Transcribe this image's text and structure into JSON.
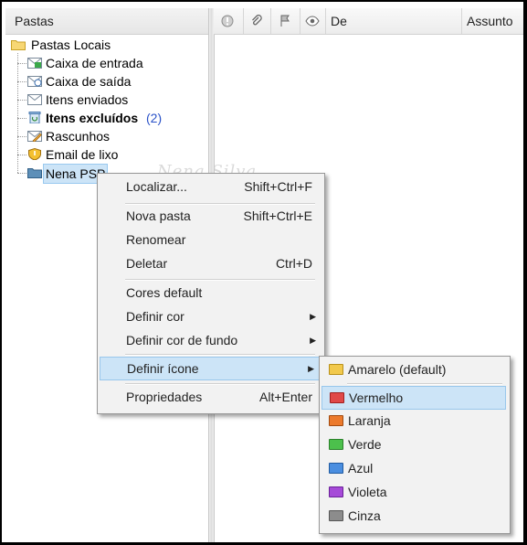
{
  "folders_panel": {
    "header": "Pastas",
    "root": "Pastas Locais",
    "items": [
      {
        "label": "Caixa de entrada",
        "icon": "inbox-icon"
      },
      {
        "label": "Caixa de saída",
        "icon": "outbox-icon"
      },
      {
        "label": "Itens enviados",
        "icon": "sent-icon"
      },
      {
        "label": "Itens excluídos",
        "count": "(2)",
        "icon": "trash-icon"
      },
      {
        "label": "Rascunhos",
        "icon": "drafts-icon"
      },
      {
        "label": "Email de lixo",
        "icon": "junk-icon"
      },
      {
        "label": "Nena PSP",
        "icon": "folder-icon"
      }
    ]
  },
  "messages_header": {
    "col_from": "De",
    "col_subject": "Assunto"
  },
  "watermark": "Nena Silva",
  "context_menu": {
    "items": [
      {
        "label": "Localizar...",
        "shortcut": "Shift+Ctrl+F"
      },
      {
        "label": "Nova pasta",
        "shortcut": "Shift+Ctrl+E"
      },
      {
        "label": "Renomear",
        "shortcut": ""
      },
      {
        "label": "Deletar",
        "shortcut": "Ctrl+D"
      },
      {
        "label": "Cores default",
        "shortcut": ""
      },
      {
        "label": "Definir cor",
        "shortcut": ""
      },
      {
        "label": "Definir cor de fundo",
        "shortcut": ""
      },
      {
        "label": "Definir ícone",
        "shortcut": ""
      },
      {
        "label": "Propriedades",
        "shortcut": "Alt+Enter"
      }
    ]
  },
  "icon_submenu": {
    "items": [
      {
        "label": "Amarelo (default)",
        "color": "#f2c94c"
      },
      {
        "label": "Vermelho",
        "color": "#e04848"
      },
      {
        "label": "Laranja",
        "color": "#ec7a2c"
      },
      {
        "label": "Verde",
        "color": "#4cc04c"
      },
      {
        "label": "Azul",
        "color": "#4a8ee0"
      },
      {
        "label": "Violeta",
        "color": "#a64ad8"
      },
      {
        "label": "Cinza",
        "color": "#8c8c8c"
      }
    ]
  }
}
